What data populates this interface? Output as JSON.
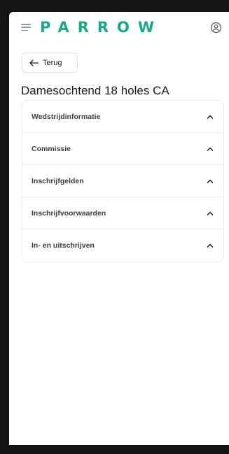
{
  "colors": {
    "accent": "#1aa888",
    "chevron": "#333333"
  },
  "header": {
    "logo": "PARROW",
    "menu_icon": "hamburger-icon",
    "user_icon": "user-circle-icon"
  },
  "back": {
    "label": "Terug",
    "icon": "arrow-left-icon"
  },
  "page": {
    "title": "Damesochtend 18 holes CA"
  },
  "sections": [
    {
      "label": "Wedstrijdinformatie",
      "icon": "chevron-up-icon"
    },
    {
      "label": "Commissie",
      "icon": "chevron-up-icon"
    },
    {
      "label": "Inschrijfgelden",
      "icon": "chevron-up-icon"
    },
    {
      "label": "Inschrijfvoorwaarden",
      "icon": "chevron-up-icon"
    },
    {
      "label": "In- en uitschrijven",
      "icon": "chevron-up-icon"
    }
  ]
}
